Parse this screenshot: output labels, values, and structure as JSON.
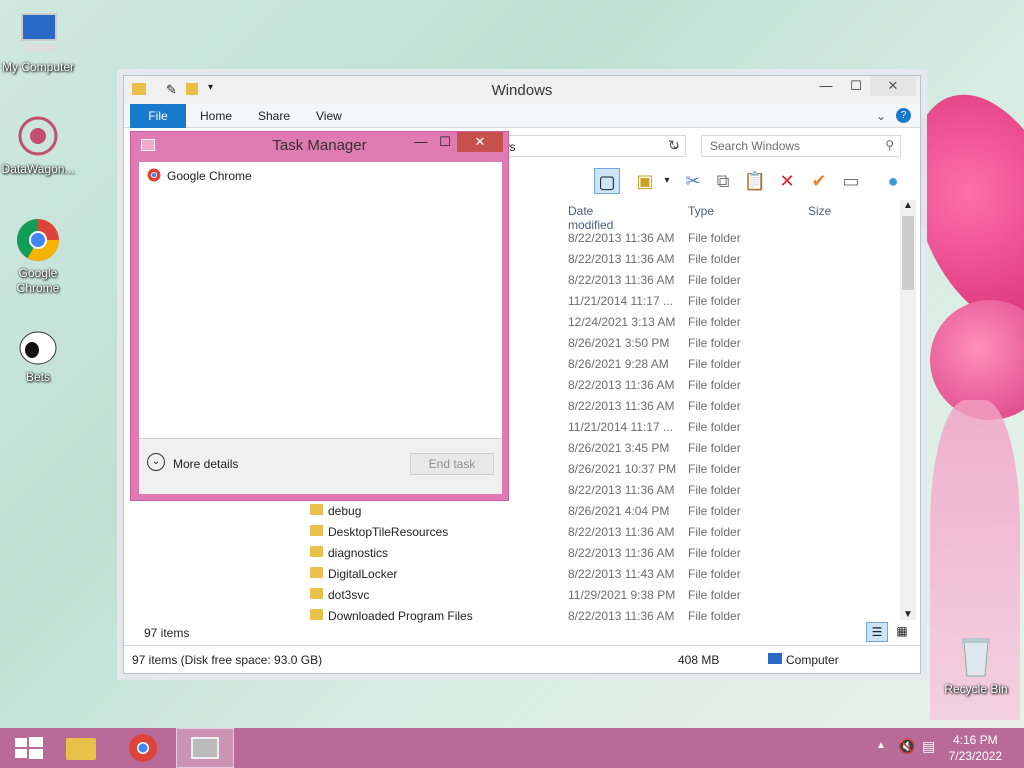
{
  "desktop": {
    "icons": [
      {
        "label": "My Computer"
      },
      {
        "label": "DataWagon..."
      },
      {
        "label": "Google Chrome"
      },
      {
        "label": "Bets"
      },
      {
        "label": "Recycle Bin"
      }
    ]
  },
  "explorer": {
    "title": "Windows",
    "tabs": [
      "File",
      "Home",
      "Share",
      "View"
    ],
    "address_partial": "ws",
    "search_placeholder": "Search Windows",
    "columns": {
      "date": "Date modified",
      "type": "Type",
      "size": "Size"
    },
    "rows": [
      {
        "name": "",
        "date": "8/22/2013 11:36 AM",
        "type": "File folder"
      },
      {
        "name": "",
        "date": "8/22/2013 11:36 AM",
        "type": "File folder"
      },
      {
        "name": "",
        "date": "8/22/2013 11:36 AM",
        "type": "File folder"
      },
      {
        "name": "",
        "date": "11/21/2014 11:17 ...",
        "type": "File folder"
      },
      {
        "name": "",
        "date": "12/24/2021 3:13 AM",
        "type": "File folder"
      },
      {
        "name": "",
        "date": "8/26/2021 3:50 PM",
        "type": "File folder"
      },
      {
        "name": "",
        "date": "8/26/2021 9:28 AM",
        "type": "File folder"
      },
      {
        "name": "",
        "date": "8/22/2013 11:36 AM",
        "type": "File folder"
      },
      {
        "name": "",
        "date": "8/22/2013 11:36 AM",
        "type": "File folder"
      },
      {
        "name": "",
        "date": "11/21/2014 11:17 ...",
        "type": "File folder"
      },
      {
        "name": "",
        "date": "8/26/2021 3:45 PM",
        "type": "File folder"
      },
      {
        "name": "",
        "date": "8/26/2021 10:37 PM",
        "type": "File folder"
      },
      {
        "name": "",
        "date": "8/22/2013 11:36 AM",
        "type": "File folder"
      },
      {
        "name": "debug",
        "date": "8/26/2021 4:04 PM",
        "type": "File folder"
      },
      {
        "name": "DesktopTileResources",
        "date": "8/22/2013 11:36 AM",
        "type": "File folder"
      },
      {
        "name": "diagnostics",
        "date": "8/22/2013 11:36 AM",
        "type": "File folder"
      },
      {
        "name": "DigitalLocker",
        "date": "8/22/2013 11:43 AM",
        "type": "File folder"
      },
      {
        "name": "dot3svc",
        "date": "11/29/2021 9:38 PM",
        "type": "File folder"
      },
      {
        "name": "Downloaded Program Files",
        "date": "8/22/2013 11:36 AM",
        "type": "File folder"
      }
    ],
    "items_count": "97 items",
    "status": {
      "left": "97 items (Disk free space: 93.0 GB)",
      "size": "408 MB",
      "location": "Computer"
    }
  },
  "taskmgr": {
    "title": "Task Manager",
    "apps": [
      "Google Chrome"
    ],
    "more_details": "More details",
    "end_task": "End task"
  },
  "taskbar": {
    "time": "4:16 PM",
    "date": "7/23/2022"
  }
}
